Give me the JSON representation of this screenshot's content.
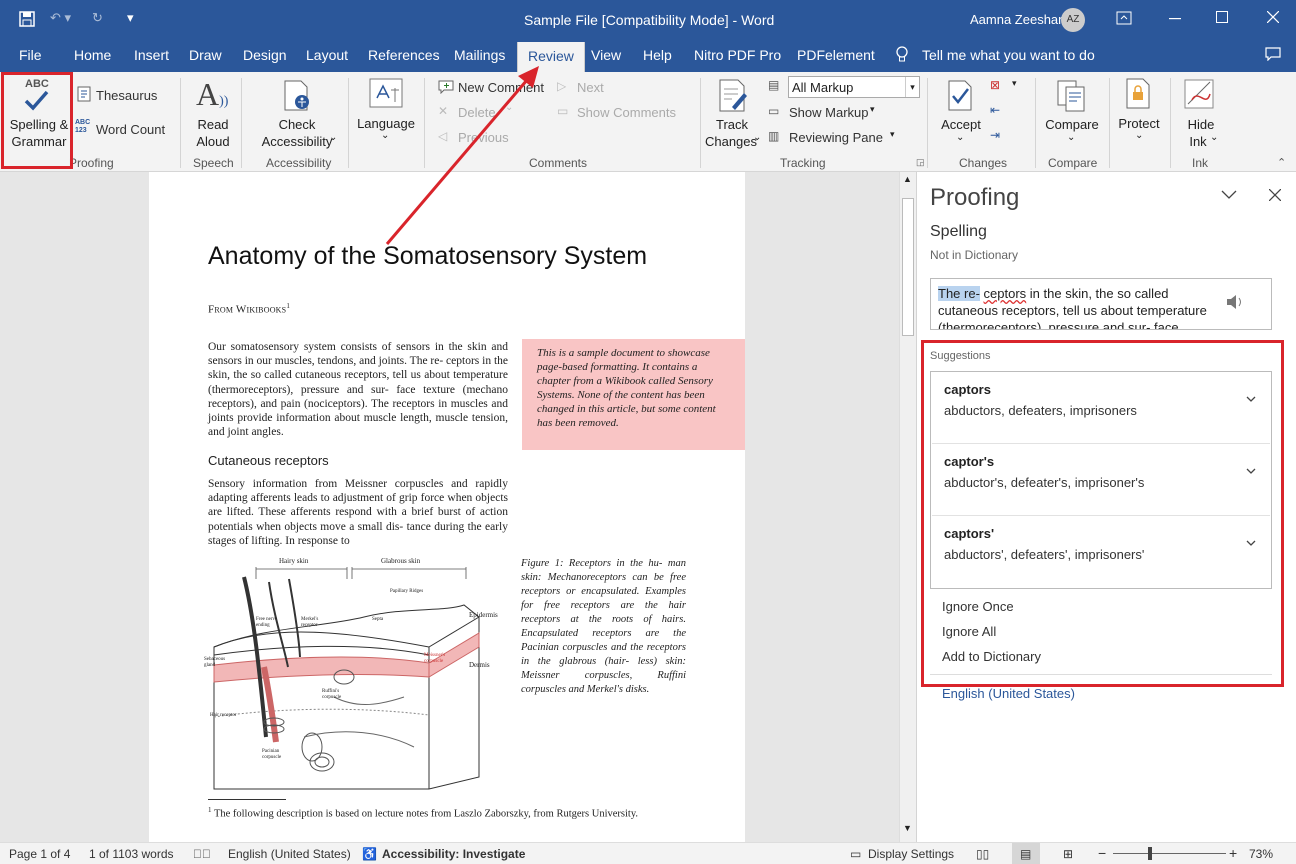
{
  "window": {
    "title": "Sample File [Compatibility Mode]  -  Word",
    "user": "Aamna Zeeshan",
    "initials": "AZ"
  },
  "tabs": [
    "File",
    "Home",
    "Insert",
    "Draw",
    "Design",
    "Layout",
    "References",
    "Mailings",
    "Review",
    "View",
    "Help",
    "Nitro PDF Pro",
    "PDFelement"
  ],
  "tell_me": "Tell me what you want to do",
  "ribbon": {
    "spelling_abc": "ABC",
    "spelling_line1": "Spelling &",
    "spelling_line2": "Grammar",
    "thesaurus": "Thesaurus",
    "word_count": "Word Count",
    "proofing": "Proofing",
    "read1": "Read",
    "read2": "Aloud",
    "speech": "Speech",
    "check1": "Check",
    "check2": "Accessibility",
    "accessibility": "Accessibility",
    "language": "Language",
    "new_comment": "New Comment",
    "delete": "Delete",
    "previous": "Previous",
    "next": "Next",
    "show_comments": "Show Comments",
    "comments": "Comments",
    "track1": "Track",
    "track2": "Changes",
    "markup_select": "All Markup",
    "show_markup": "Show Markup",
    "reviewing_pane": "Reviewing Pane",
    "tracking": "Tracking",
    "accept": "Accept",
    "changes": "Changes",
    "compare": "Compare",
    "compare_group": "Compare",
    "protect": "Protect",
    "hide1": "Hide",
    "hide2": "Ink",
    "ink": "Ink"
  },
  "document": {
    "title": "Anatomy of the Somatosensory System",
    "from": "From Wikibooks",
    "from_sup": "1",
    "p1": "Our somatosensory system consists of sensors in the skin and sensors in our muscles, tendons, and joints. The re- ceptors in the skin, the so called cutaneous receptors, tell us about temperature (thermoreceptors), pressure and sur- face texture (mechano receptors), and pain (nociceptors). The receptors in muscles and joints provide information about muscle length, muscle tension, and joint angles.",
    "box": "This is a sample document to showcase page-based formatting. It contains a chapter from a Wikibook called Sensory Systems. None of the content has been changed in this article, but some content has been removed.",
    "h2": "Cutaneous receptors",
    "p2": "Sensory information from Meissner corpuscles and rapidly adapting afferents leads to adjustment of grip force when objects are lifted. These afferents respond with a brief burst of action potentials when objects move a small dis- tance during the early stages of lifting. In response to",
    "caption": "Figure 1: Receptors in the hu- man skin: Mechanoreceptors can be free receptors or encapsulated. Examples for free receptors are the hair receptors at the roots of hairs. Encapsulated receptors are the Pacinian corpuscles and the receptors in the glabrous (hair- less) skin: Meissner corpuscles, Ruffini corpuscles and Merkel's disks.",
    "fig_labels": {
      "hairy": "Hairy skin",
      "glabrous": "Glabrous skin",
      "papillary": "Papillary Ridges",
      "free": "Free nerve ending",
      "merkel": "Merkel's receptor",
      "septa": "Septa",
      "epidermis": "Epidermis",
      "dermis": "Dermis",
      "meissner": "Meissner's corpuscle",
      "sebaceous": "Sebaceous gland",
      "ruffini": "Ruffini's corpuscle",
      "hair": "Hair receptor",
      "pacinian": "Pacinian corpuscle"
    },
    "footnote_sup": "1",
    "footnote": "The following description is based on lecture notes from Laszlo Zaborszky, from Rutgers University."
  },
  "pane": {
    "title": "Proofing",
    "section": "Spelling",
    "sub": "Not in Dictionary",
    "context_hl": "The re-",
    "context_err": "ceptors",
    "context_rest": " in the skin, the so called cutaneous receptors, tell us about temperature (thermoreceptors), pressure and sur- face",
    "suggestions_label": "Suggestions",
    "suggestions": [
      {
        "word": "captors",
        "syn": "abductors, defeaters, imprisoners"
      },
      {
        "word": "captor's",
        "syn": "abductor's, defeater's, imprisoner's"
      },
      {
        "word": "captors'",
        "syn": "abductors', defeaters', imprisoners'"
      }
    ],
    "ignore_once": "Ignore Once",
    "ignore_all": "Ignore All",
    "add_dict": "Add to Dictionary",
    "language": "English (United States)"
  },
  "status": {
    "page": "Page 1 of 4",
    "words": "1 of 1103 words",
    "lang": "English (United States)",
    "accessibility": "Accessibility: Investigate",
    "display": "Display Settings",
    "zoom": "73%"
  },
  "colors": {
    "accent": "#2b579a",
    "highlight_box": "#f9c5c5",
    "annotation": "#d9242b"
  }
}
